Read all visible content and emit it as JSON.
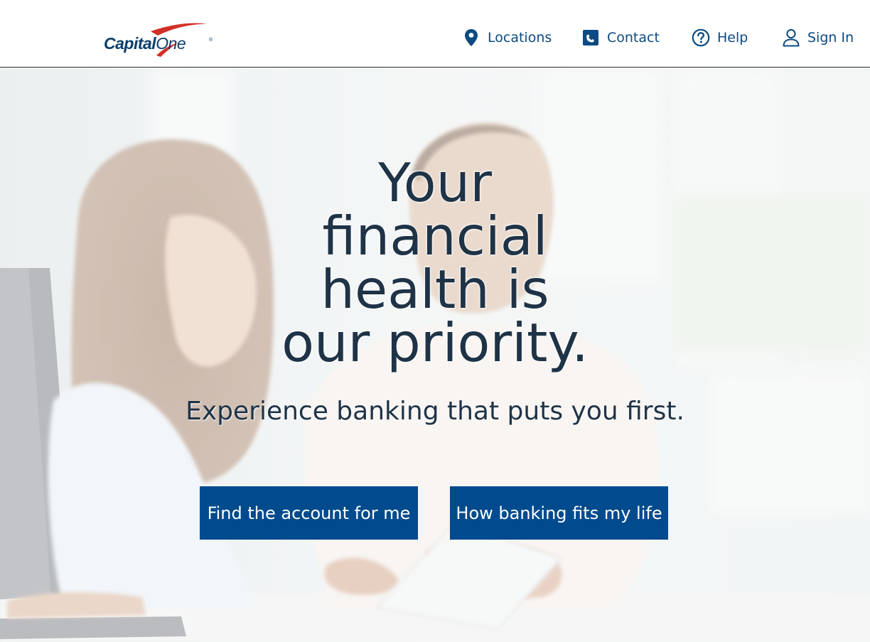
{
  "header": {
    "logo": {
      "word1": "Capital",
      "word2": "One",
      "mark": "®",
      "brand_navy": "#0b3e6b",
      "brand_red": "#d03027"
    },
    "nav": [
      {
        "label": "Locations",
        "icon": "location-pin-icon"
      },
      {
        "label": "Contact",
        "icon": "phone-icon"
      },
      {
        "label": "Help",
        "icon": "help-circle-icon"
      },
      {
        "label": "Sign In",
        "icon": "user-icon"
      }
    ],
    "nav_color": "#0b4a82"
  },
  "hero": {
    "headline": "Your financial health is our priority.",
    "subheadline": "Experience banking that puts you first.",
    "buttons": [
      {
        "label": "Find the account for me"
      },
      {
        "label": "How banking fits my life"
      }
    ],
    "button_color": "#004b8d",
    "text_color": "#1f3347"
  }
}
